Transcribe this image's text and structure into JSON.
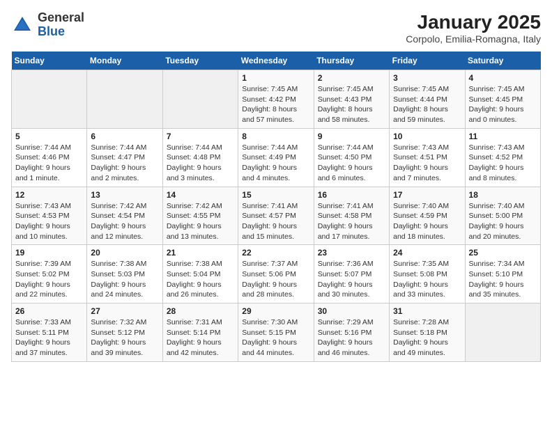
{
  "logo": {
    "general": "General",
    "blue": "Blue"
  },
  "title": "January 2025",
  "subtitle": "Corpolo, Emilia-Romagna, Italy",
  "weekdays": [
    "Sunday",
    "Monday",
    "Tuesday",
    "Wednesday",
    "Thursday",
    "Friday",
    "Saturday"
  ],
  "weeks": [
    [
      {
        "day": "",
        "info": ""
      },
      {
        "day": "",
        "info": ""
      },
      {
        "day": "",
        "info": ""
      },
      {
        "day": "1",
        "info": "Sunrise: 7:45 AM\nSunset: 4:42 PM\nDaylight: 8 hours and 57 minutes."
      },
      {
        "day": "2",
        "info": "Sunrise: 7:45 AM\nSunset: 4:43 PM\nDaylight: 8 hours and 58 minutes."
      },
      {
        "day": "3",
        "info": "Sunrise: 7:45 AM\nSunset: 4:44 PM\nDaylight: 8 hours and 59 minutes."
      },
      {
        "day": "4",
        "info": "Sunrise: 7:45 AM\nSunset: 4:45 PM\nDaylight: 9 hours and 0 minutes."
      }
    ],
    [
      {
        "day": "5",
        "info": "Sunrise: 7:44 AM\nSunset: 4:46 PM\nDaylight: 9 hours and 1 minute."
      },
      {
        "day": "6",
        "info": "Sunrise: 7:44 AM\nSunset: 4:47 PM\nDaylight: 9 hours and 2 minutes."
      },
      {
        "day": "7",
        "info": "Sunrise: 7:44 AM\nSunset: 4:48 PM\nDaylight: 9 hours and 3 minutes."
      },
      {
        "day": "8",
        "info": "Sunrise: 7:44 AM\nSunset: 4:49 PM\nDaylight: 9 hours and 4 minutes."
      },
      {
        "day": "9",
        "info": "Sunrise: 7:44 AM\nSunset: 4:50 PM\nDaylight: 9 hours and 6 minutes."
      },
      {
        "day": "10",
        "info": "Sunrise: 7:43 AM\nSunset: 4:51 PM\nDaylight: 9 hours and 7 minutes."
      },
      {
        "day": "11",
        "info": "Sunrise: 7:43 AM\nSunset: 4:52 PM\nDaylight: 9 hours and 8 minutes."
      }
    ],
    [
      {
        "day": "12",
        "info": "Sunrise: 7:43 AM\nSunset: 4:53 PM\nDaylight: 9 hours and 10 minutes."
      },
      {
        "day": "13",
        "info": "Sunrise: 7:42 AM\nSunset: 4:54 PM\nDaylight: 9 hours and 12 minutes."
      },
      {
        "day": "14",
        "info": "Sunrise: 7:42 AM\nSunset: 4:55 PM\nDaylight: 9 hours and 13 minutes."
      },
      {
        "day": "15",
        "info": "Sunrise: 7:41 AM\nSunset: 4:57 PM\nDaylight: 9 hours and 15 minutes."
      },
      {
        "day": "16",
        "info": "Sunrise: 7:41 AM\nSunset: 4:58 PM\nDaylight: 9 hours and 17 minutes."
      },
      {
        "day": "17",
        "info": "Sunrise: 7:40 AM\nSunset: 4:59 PM\nDaylight: 9 hours and 18 minutes."
      },
      {
        "day": "18",
        "info": "Sunrise: 7:40 AM\nSunset: 5:00 PM\nDaylight: 9 hours and 20 minutes."
      }
    ],
    [
      {
        "day": "19",
        "info": "Sunrise: 7:39 AM\nSunset: 5:02 PM\nDaylight: 9 hours and 22 minutes."
      },
      {
        "day": "20",
        "info": "Sunrise: 7:38 AM\nSunset: 5:03 PM\nDaylight: 9 hours and 24 minutes."
      },
      {
        "day": "21",
        "info": "Sunrise: 7:38 AM\nSunset: 5:04 PM\nDaylight: 9 hours and 26 minutes."
      },
      {
        "day": "22",
        "info": "Sunrise: 7:37 AM\nSunset: 5:06 PM\nDaylight: 9 hours and 28 minutes."
      },
      {
        "day": "23",
        "info": "Sunrise: 7:36 AM\nSunset: 5:07 PM\nDaylight: 9 hours and 30 minutes."
      },
      {
        "day": "24",
        "info": "Sunrise: 7:35 AM\nSunset: 5:08 PM\nDaylight: 9 hours and 33 minutes."
      },
      {
        "day": "25",
        "info": "Sunrise: 7:34 AM\nSunset: 5:10 PM\nDaylight: 9 hours and 35 minutes."
      }
    ],
    [
      {
        "day": "26",
        "info": "Sunrise: 7:33 AM\nSunset: 5:11 PM\nDaylight: 9 hours and 37 minutes."
      },
      {
        "day": "27",
        "info": "Sunrise: 7:32 AM\nSunset: 5:12 PM\nDaylight: 9 hours and 39 minutes."
      },
      {
        "day": "28",
        "info": "Sunrise: 7:31 AM\nSunset: 5:14 PM\nDaylight: 9 hours and 42 minutes."
      },
      {
        "day": "29",
        "info": "Sunrise: 7:30 AM\nSunset: 5:15 PM\nDaylight: 9 hours and 44 minutes."
      },
      {
        "day": "30",
        "info": "Sunrise: 7:29 AM\nSunset: 5:16 PM\nDaylight: 9 hours and 46 minutes."
      },
      {
        "day": "31",
        "info": "Sunrise: 7:28 AM\nSunset: 5:18 PM\nDaylight: 9 hours and 49 minutes."
      },
      {
        "day": "",
        "info": ""
      }
    ]
  ]
}
